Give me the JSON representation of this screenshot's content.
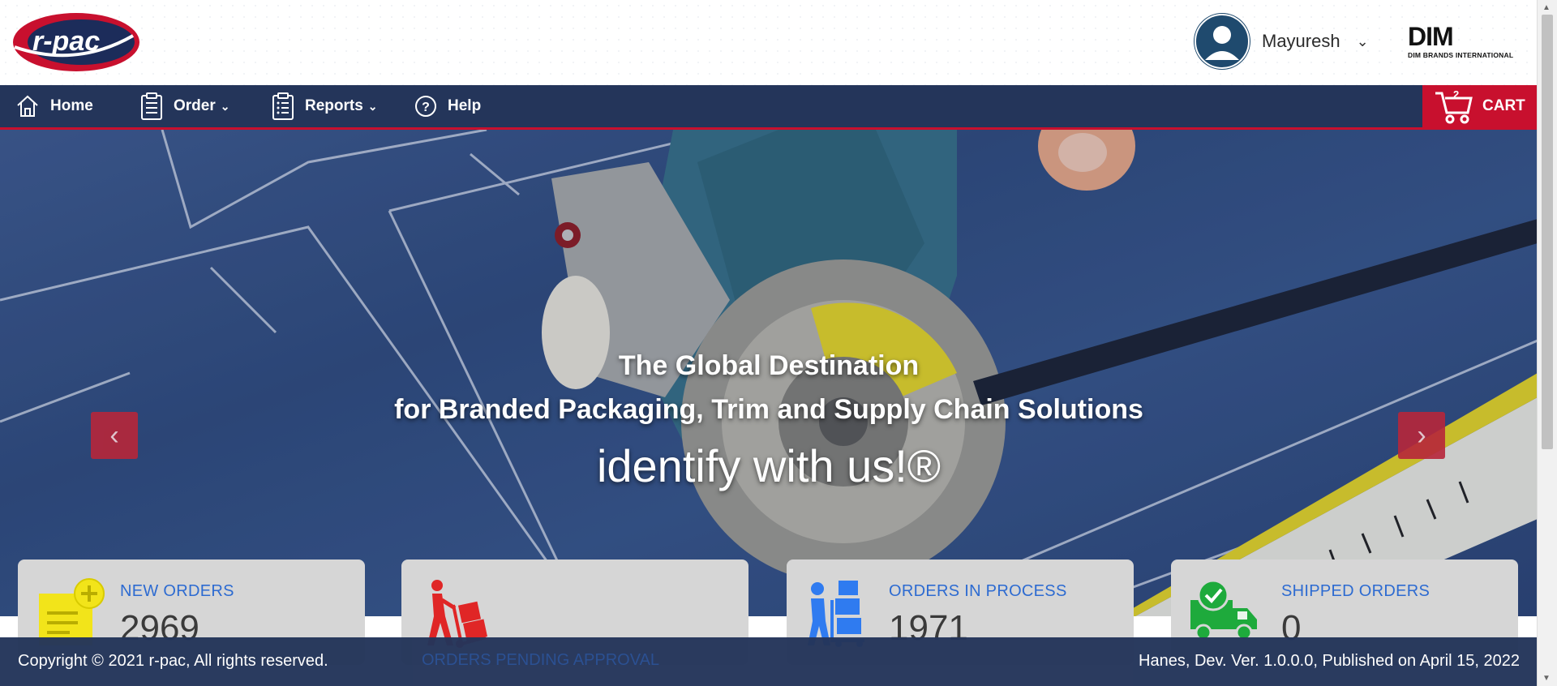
{
  "header": {
    "logo_text": "r-pac",
    "user_name": "Mayuresh",
    "brand_logo_big": "DIM",
    "brand_logo_small": "DIM BRANDS INTERNATIONAL"
  },
  "nav": {
    "items": [
      {
        "label": "Home",
        "icon": "home-icon"
      },
      {
        "label": "Order",
        "icon": "clipboard-icon",
        "dropdown": true
      },
      {
        "label": "Reports",
        "icon": "report-clipboard-icon",
        "dropdown": true
      },
      {
        "label": "Help",
        "icon": "help-circle-icon"
      }
    ],
    "cart_label": "CART",
    "cart_count": "2"
  },
  "hero": {
    "line1": "The Global Destination",
    "line2": "for Branded Packaging, Trim and Supply Chain Solutions",
    "tagline": "identify with us!®"
  },
  "cards": [
    {
      "label": "NEW ORDERS",
      "value": "2969",
      "icon": "new-order-note-icon"
    },
    {
      "label": "ORDERS PENDING APPROVAL",
      "value": "",
      "icon": "hand-truck-icon"
    },
    {
      "label": "ORDERS IN PROCESS",
      "value": "1971",
      "icon": "worker-boxes-icon"
    },
    {
      "label": "SHIPPED ORDERS",
      "value": "0",
      "icon": "delivery-truck-icon"
    }
  ],
  "footer": {
    "copyright": "Copyright © 2021 r-pac, All rights reserved.",
    "version": "Hanes, Dev. Ver. 1.0.0.0, Published on April 15, 2022"
  },
  "colors": {
    "nav_bg": "#24355a",
    "accent_red": "#c8102e",
    "card_label_blue": "#2d6bd1"
  }
}
